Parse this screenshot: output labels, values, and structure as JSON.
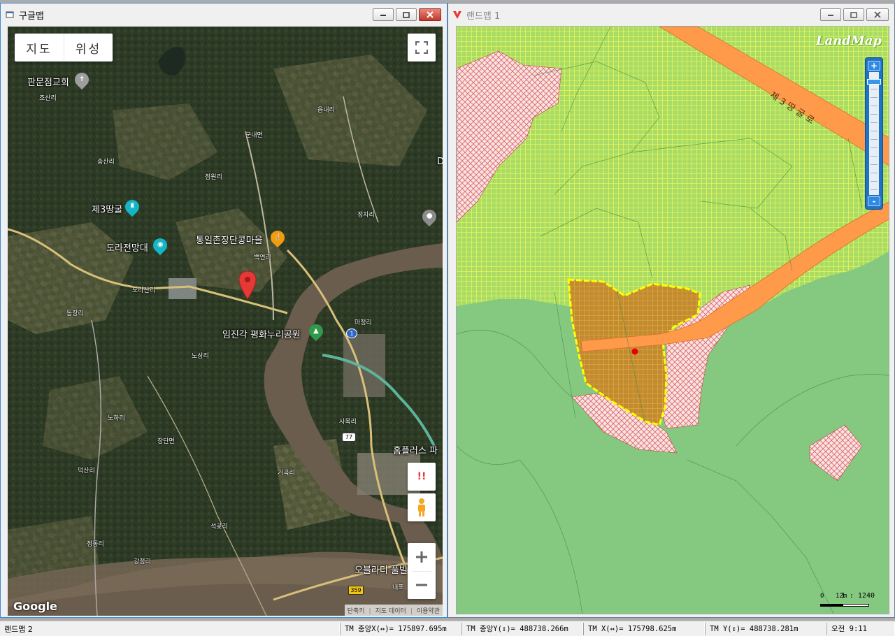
{
  "google_window": {
    "title": "구글맵",
    "map_type": {
      "map": "지도",
      "satellite": "위성"
    },
    "labels": {
      "panmunjeom": "판문점교회",
      "josanri": "조산리",
      "eupnaeri": "읍내리",
      "gunnaemyeon": "군내면",
      "songsanri": "송산리",
      "jeomwonri": "점원리",
      "tunnel3": "제3땅굴",
      "jeongjari": "정자리",
      "unification_village": "통일촌장단콩마을",
      "baekyeonri": "백연리",
      "dora_observatory": "도라전망대",
      "dorasanri": "도라산리",
      "dongjangri": "동장리",
      "majeongri": "마정리",
      "imjingak": "임진각 평화누리공원",
      "nosangri": "노상리",
      "hahari": "노하리",
      "sanokri": "사목리",
      "jangdanmyeon": "장단면",
      "geogokri": "거곡리",
      "deoksanri": "덕산리",
      "seokgotri": "석곶리",
      "jeongdongri": "정동리",
      "gangjeongri": "강정리",
      "homeplus": "홈플러스 파",
      "oblardi": "오블라디 풀빌",
      "naepo": "내포",
      "road_marker_1": "1",
      "road_marker_77": "77",
      "road_marker_359": "359",
      "edge_d": "D"
    },
    "logo": "Google",
    "attribution": [
      "단축키",
      "지도 데이터",
      "이용약관"
    ],
    "alert_glyph": "!!"
  },
  "landmap_window": {
    "title": "랜드맵 1",
    "logo": "LandMap",
    "road_label": "제 3 땅 굴 로",
    "zoom_in": "+",
    "zoom_out": "-",
    "scale_ratio": "1 : 1240",
    "scale_zero": "0",
    "scale_len": "12m"
  },
  "status_bar": {
    "app_name": "랜드맵 2",
    "tm_center_x": "TM 중앙X(↔)= 175897.695m",
    "tm_center_y": "TM 중앙Y(↕)= 488738.266m",
    "tm_x": "TM X(↔)= 175798.625m",
    "tm_y": "TM Y(↕)= 488738.281m",
    "time": "오전 9:11"
  },
  "colors": {
    "forest": "#2f3d27",
    "field": "#6e6d47",
    "river": "#6a5a4a",
    "landmap_green": "#85c981",
    "landmap_grid": "#d8f26a",
    "road_orange": "#ff9a4a",
    "parcel_yellow": "#ffff00",
    "pin_red": "#e53935"
  }
}
